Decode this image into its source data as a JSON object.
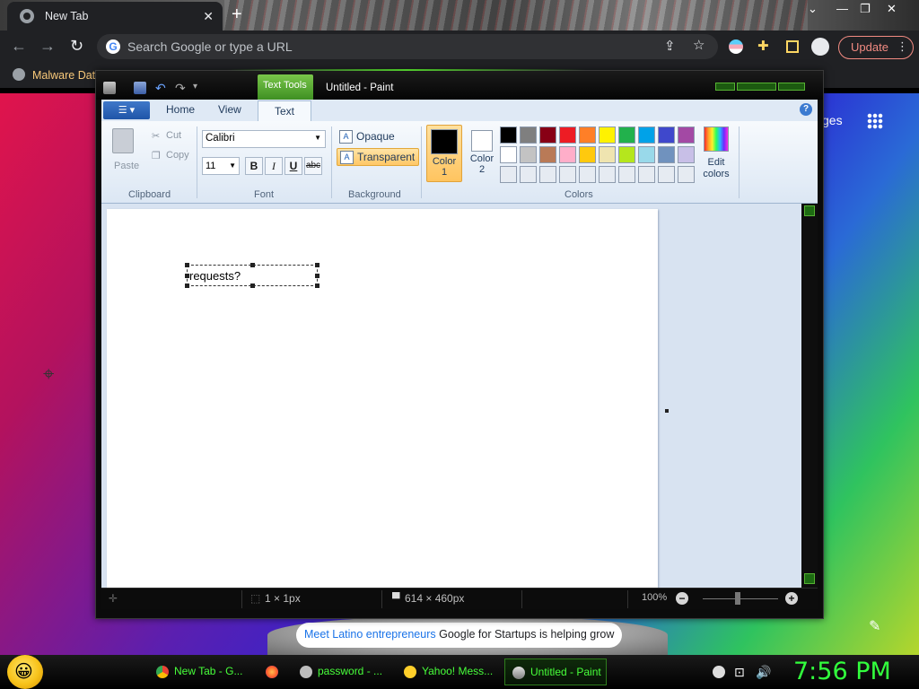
{
  "browser": {
    "tab_title": "New Tab",
    "tab_close": "✕",
    "new_tab": "+",
    "window_controls": [
      "⌄",
      "—",
      "❐",
      "✕"
    ],
    "omnibox_placeholder": "Search Google or type a URL",
    "update_label": "Update",
    "bookmark": "Malware Dat"
  },
  "new_tab_page": {
    "top_right_text": "ges",
    "promo_link": "Meet Latino entrepreneurs",
    "promo_text": "Google for Startups is helping grow"
  },
  "paint": {
    "contextual_tab": "Text Tools",
    "window_title": "Untitled - Paint",
    "ribbon_tabs": [
      "Home",
      "View",
      "Text"
    ],
    "active_tab": "Text",
    "clipboard": {
      "paste": "Paste",
      "cut": "Cut",
      "copy": "Copy",
      "label": "Clipboard"
    },
    "font": {
      "family": "Calibri",
      "size": "11",
      "label": "Font",
      "bold": "B",
      "italic": "I",
      "underline": "U",
      "strike": "abc"
    },
    "background": {
      "opaque": "Opaque",
      "transparent": "Transparent",
      "label": "Background",
      "selected": "Transparent"
    },
    "colors": {
      "color1_label": "Color\n1",
      "color1_a": "Color",
      "color1_b": "1",
      "color2_a": "Color",
      "color2_b": "2",
      "color1": "#000000",
      "color2": "#ffffff",
      "edit_a": "Edit",
      "edit_b": "colors",
      "label": "Colors",
      "palette": [
        [
          "#000000",
          "#7f7f7f",
          "#880015",
          "#ed1c24",
          "#ff7f27",
          "#fff200",
          "#22b14c",
          "#00a2e8",
          "#3f48cc",
          "#a349a4"
        ],
        [
          "#ffffff",
          "#c3c3c3",
          "#b97a57",
          "#ffaec9",
          "#ffc90e",
          "#efe4b0",
          "#b5e61d",
          "#99d9ea",
          "#7092be",
          "#c8bfe7"
        ],
        [
          "#e6ebf2",
          "#e6ebf2",
          "#e6ebf2",
          "#e6ebf2",
          "#e6ebf2",
          "#e6ebf2",
          "#e6ebf2",
          "#e6ebf2",
          "#e6ebf2",
          "#e6ebf2"
        ]
      ]
    },
    "canvas_text": "requests?",
    "status": {
      "cursor_pos": "1 × 1px",
      "canvas_size": "614 × 460px",
      "zoom": "100%"
    }
  },
  "taskbar": {
    "items": [
      {
        "label": "New Tab - G...",
        "icon": "chrome-icon"
      },
      {
        "label": "",
        "icon": "firefox-icon"
      },
      {
        "label": "password - ...",
        "icon": "app-icon"
      },
      {
        "label": "Yahoo! Mess...",
        "icon": "yahoo-messenger-icon"
      },
      {
        "label": "Untitled - Paint",
        "icon": "paint-icon"
      }
    ],
    "clock": "7:56 PM"
  }
}
